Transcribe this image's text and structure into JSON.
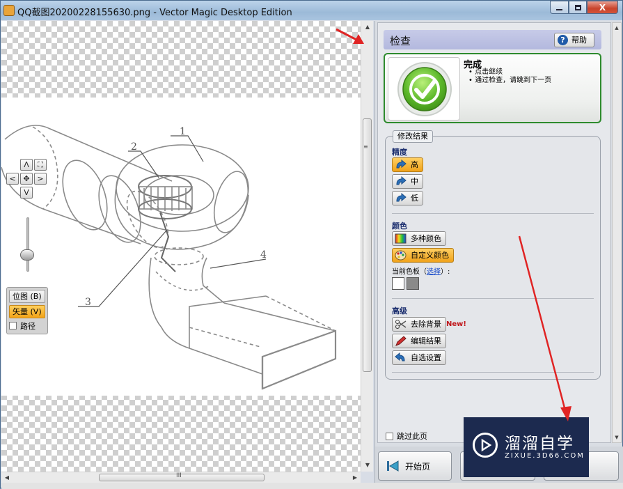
{
  "window": {
    "title": "QQ截图20200228155630.png - Vector Magic Desktop Edition",
    "min_icon": "minimize-icon",
    "max_icon": "maximize-icon",
    "close_label": "X"
  },
  "canvas": {
    "callouts": [
      "1",
      "2",
      "3",
      "4"
    ]
  },
  "nav_pad": {
    "up": "Λ",
    "down": "V",
    "left": "<",
    "right": ">",
    "fit_icon": "fit-icon",
    "center_icon": "pan-icon"
  },
  "view_mode": {
    "bitmap_label": "位图 (B)",
    "vector_label": "矢量 (V)",
    "path_label": "路径",
    "active": "vector"
  },
  "panel": {
    "header": "检查",
    "help_label": "帮助",
    "done": {
      "title": "完成",
      "bullets": [
        "点击继续",
        "通过检查，请跳到下一页"
      ]
    },
    "group_title": "修改结果",
    "precision": {
      "label": "精度",
      "options": [
        "高",
        "中",
        "低"
      ],
      "selected": "高"
    },
    "color": {
      "label": "颜色",
      "multi": "多种颜色",
      "custom": "自定义颜色",
      "selected": "自定义颜色",
      "palette_prefix": "当前色板",
      "palette_link": "选择",
      "palette_open": "（",
      "palette_close": "）:",
      "swatches": [
        "#ffffff",
        "#8a8a8a"
      ]
    },
    "advanced": {
      "label": "高级",
      "remove_bg": "去除背景",
      "new_tag": "New!",
      "edit_result": "编辑结果",
      "custom_settings": "自选设置"
    },
    "skip_label": "跳过此页",
    "bottom": {
      "home_label": "开始页"
    }
  },
  "watermark": {
    "title": "溜溜自学",
    "subtitle": "ZIXUE.3D66.COM"
  },
  "colors": {
    "accent": "#f0a21b",
    "header": "#b3b8de",
    "done_border": "#2e8b2e",
    "annotation": "#e02424"
  }
}
